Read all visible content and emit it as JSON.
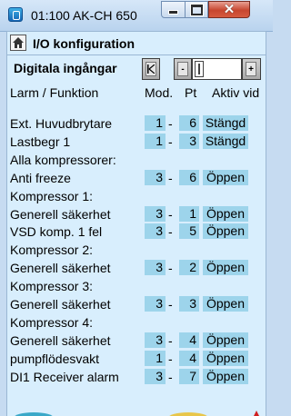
{
  "window": {
    "title": "01:100 AK-CH 650"
  },
  "header": {
    "title": "I/O konfiguration"
  },
  "section": {
    "title": "Digitala ingångar"
  },
  "columns": {
    "name": "Larm / Funktion",
    "mod": "Mod.",
    "pt": "Pt",
    "active": "Aktiv vid"
  },
  "pager": {
    "next_label": "+",
    "prev_label": "-"
  },
  "rows": [
    {
      "label": "Ext. Huvudbrytare",
      "mod": "1",
      "pt": "6",
      "active": "Stängd"
    },
    {
      "label": "Lastbegr 1",
      "mod": "1",
      "pt": "3",
      "active": "Stängd"
    },
    {
      "label": "Alla kompressorer:"
    },
    {
      "label": "Anti freeze",
      "mod": "3",
      "pt": "6",
      "active": "Öppen"
    },
    {
      "label": "Kompressor 1:"
    },
    {
      "label": "Generell säkerhet",
      "mod": "3",
      "pt": "1",
      "active": "Öppen"
    },
    {
      "label": "VSD komp. 1 fel",
      "mod": "3",
      "pt": "5",
      "active": "Öppen"
    },
    {
      "label": "Kompressor 2:"
    },
    {
      "label": "Generell säkerhet",
      "mod": "3",
      "pt": "2",
      "active": "Öppen"
    },
    {
      "label": "Kompressor 3:"
    },
    {
      "label": "Generell säkerhet",
      "mod": "3",
      "pt": "3",
      "active": "Öppen"
    },
    {
      "label": "Kompressor 4:"
    },
    {
      "label": "Generell säkerhet",
      "mod": "3",
      "pt": "4",
      "active": "Öppen"
    },
    {
      "label": "pumpflödesvakt",
      "mod": "1",
      "pt": "4",
      "active": "Öppen"
    },
    {
      "label": "DI1 Receiver alarm",
      "mod": "3",
      "pt": "7",
      "active": "Öppen"
    }
  ],
  "dash": "-"
}
